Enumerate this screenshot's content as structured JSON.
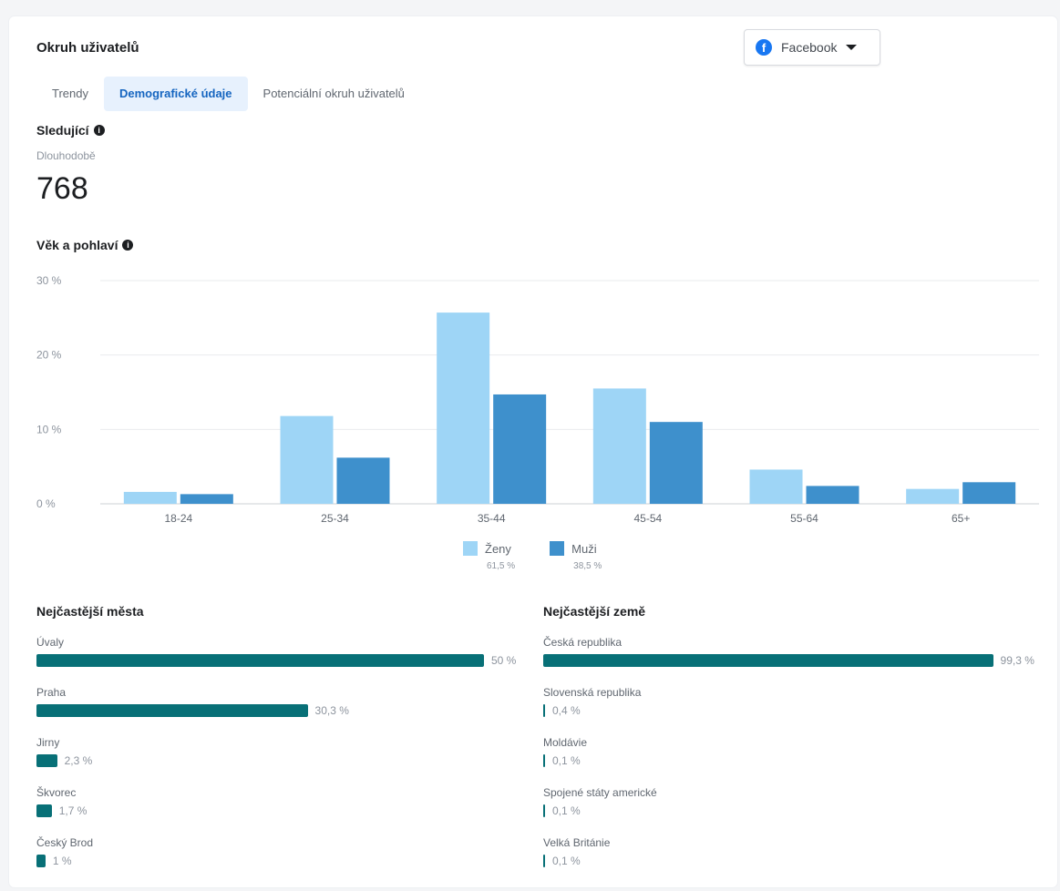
{
  "header": {
    "title": "Okruh uživatelů",
    "platform": "Facebook",
    "platform_icon": "facebook-icon",
    "accent": "#1877f2"
  },
  "tabs": [
    {
      "label": "Trendy",
      "active": false
    },
    {
      "label": "Demografické údaje",
      "active": true
    },
    {
      "label": "Potenciální okruh uživatelů",
      "active": false
    }
  ],
  "followers": {
    "title": "Sledující",
    "period": "Dlouhodobě",
    "count": "768"
  },
  "age_gender": {
    "title": "Věk a pohlaví"
  },
  "chart_data": {
    "type": "bar",
    "categories": [
      "18-24",
      "25-34",
      "35-44",
      "45-54",
      "55-64",
      "65+"
    ],
    "series": [
      {
        "name": "Ženy",
        "total": "61,5 %",
        "color": "#9ed5f6",
        "values": [
          1.6,
          11.8,
          25.7,
          15.5,
          4.6,
          2.0
        ]
      },
      {
        "name": "Muži",
        "total": "38,5 %",
        "color": "#3e90cc",
        "values": [
          1.3,
          6.2,
          14.7,
          11.0,
          2.4,
          2.9
        ]
      }
    ],
    "yticks": [
      "0 %",
      "10 %",
      "20 %",
      "30 %"
    ],
    "ylim": [
      0,
      30
    ],
    "grid": true,
    "legend": "bottom"
  },
  "top_cities": {
    "title": "Nejčastější města",
    "bar_color": "#087077",
    "items": [
      {
        "label": "Úvaly",
        "value": "50 %",
        "pct": 50
      },
      {
        "label": "Praha",
        "value": "30,3 %",
        "pct": 30.3
      },
      {
        "label": "Jirny",
        "value": "2,3 %",
        "pct": 2.3
      },
      {
        "label": "Škvorec",
        "value": "1,7 %",
        "pct": 1.7
      },
      {
        "label": "Český Brod",
        "value": "1 %",
        "pct": 1
      }
    ]
  },
  "top_countries": {
    "title": "Nejčastější země",
    "bar_color": "#087077",
    "items": [
      {
        "label": "Česká republika",
        "value": "99,3 %",
        "pct": 99.3
      },
      {
        "label": "Slovenská republika",
        "value": "0,4 %",
        "pct": 0.4
      },
      {
        "label": "Moldávie",
        "value": "0,1 %",
        "pct": 0.1
      },
      {
        "label": "Spojené státy americké",
        "value": "0,1 %",
        "pct": 0.1
      },
      {
        "label": "Velká Británie",
        "value": "0,1 %",
        "pct": 0.1
      }
    ]
  }
}
